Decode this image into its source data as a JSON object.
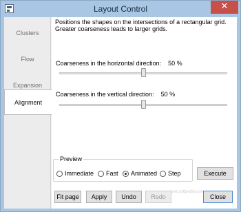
{
  "window": {
    "title": "Layout Control",
    "close_glyph": "✕"
  },
  "tabs": [
    {
      "label": "Clusters",
      "active": false
    },
    {
      "label": "Flow",
      "active": false
    },
    {
      "label": "Expansion",
      "active": false
    },
    {
      "label": "Alignment",
      "active": true
    }
  ],
  "alignment": {
    "description": "Positions the shapes on the intersections of a rectangular grid.  Greater coarseness  leads to larger grids.",
    "horizontal": {
      "label": "Coarseness in the horizontal direction:",
      "value_text": "50 %",
      "value": 50
    },
    "vertical": {
      "label": "Coarseness in the vertical direction:",
      "value_text": "50 %",
      "value": 50
    }
  },
  "preview": {
    "label": "Preview",
    "options": [
      {
        "label": "Immediate",
        "selected": false
      },
      {
        "label": "Fast",
        "selected": false
      },
      {
        "label": "Animated",
        "selected": true
      },
      {
        "label": "Step",
        "selected": false
      }
    ]
  },
  "buttons": {
    "execute": "Execute",
    "fit_page": "Fit page",
    "apply": "Apply",
    "undo": "Undo",
    "redo": "Redo",
    "close": "Close"
  },
  "watermark": "www.softpedia.com"
}
